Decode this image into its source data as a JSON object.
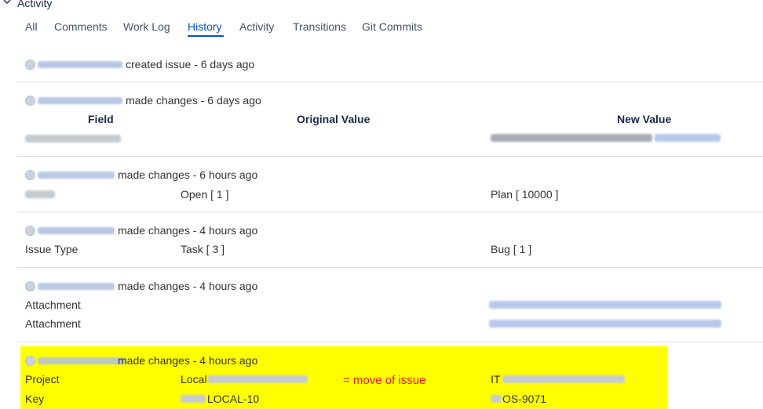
{
  "section": {
    "title": "Activity",
    "icon": "chevron-down-icon"
  },
  "tabs": [
    {
      "label": "All",
      "active": false
    },
    {
      "label": "Comments",
      "active": false
    },
    {
      "label": "Work Log",
      "active": false
    },
    {
      "label": "History",
      "active": true
    },
    {
      "label": "Activity",
      "active": false
    },
    {
      "label": "Transitions",
      "active": false
    },
    {
      "label": "Git Commits",
      "active": false
    }
  ],
  "entries": [
    {
      "action": "created issue - 6 days ago"
    },
    {
      "action": "made changes - 6 days ago",
      "headers": {
        "field": "Field",
        "original": "Original Value",
        "new": "New Value"
      }
    },
    {
      "action": "made changes - 6 hours ago",
      "original": "Open [ 1 ]",
      "new": "Plan [ 10000 ]"
    },
    {
      "action": "made changes - 4 hours ago",
      "field": "Issue Type",
      "original": "Task [ 3 ]",
      "new": "Bug [ 1 ]"
    },
    {
      "action": "made changes - 4 hours ago",
      "rows": [
        {
          "field": "Attachment"
        },
        {
          "field": "Attachment"
        }
      ]
    },
    {
      "action": "made changes - 4 hours ago",
      "highlight_color": "#ffff00",
      "annotation": "= move of issue",
      "annotation_color": "#e8191e",
      "rows": [
        {
          "field": "Project",
          "original": "Local",
          "new": "IT"
        },
        {
          "field": "Key",
          "original": "LOCAL-10",
          "new": "OS-9071"
        }
      ]
    }
  ],
  "colors": {
    "tab_active": "#0052cc",
    "tab": "#42526e",
    "separator": "#d8dde4"
  }
}
